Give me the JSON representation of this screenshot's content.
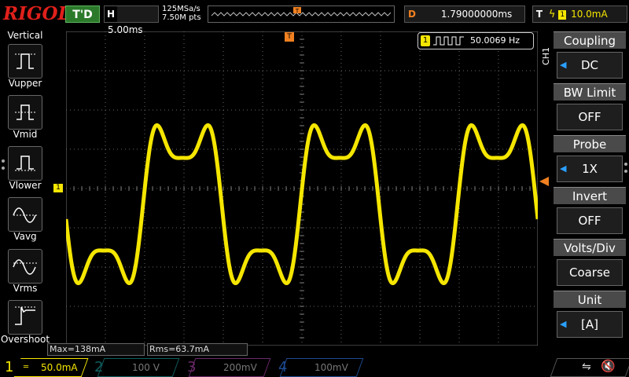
{
  "header": {
    "brand": "RIGOL",
    "trigger_status": "T'D",
    "timebase_label": "H",
    "timebase_value": "5.00ms",
    "sample_rate": "125MSa/s",
    "memory_points": "7.50M pts",
    "delay_label": "D",
    "delay_value": "1.79000000ms",
    "trigger_label": "T",
    "trigger_level": "10.0mA"
  },
  "left_menu": {
    "title": "Vertical",
    "items": [
      {
        "label": "Vupper",
        "icon": "vupper-icon"
      },
      {
        "label": "Vmid",
        "icon": "vmid-icon"
      },
      {
        "label": "Vlower",
        "icon": "vlower-icon"
      },
      {
        "label": "Vavg",
        "icon": "vavg-icon"
      },
      {
        "label": "Vrms",
        "icon": "vrms-icon"
      },
      {
        "label": "Overshoot",
        "icon": "overshoot-icon"
      }
    ]
  },
  "display": {
    "frequency_counter_label": "1",
    "frequency_value": "50.0069 Hz",
    "channel_marker": "1",
    "trace_color": "#f5e600"
  },
  "measurements": {
    "max": "Max=138mA",
    "rms": "Rms=63.7mA"
  },
  "channels": [
    {
      "num": "1",
      "scale": "50.0mA",
      "color": "#f5e600",
      "active": true
    },
    {
      "num": "2",
      "scale": "100 V",
      "color": "#00c0c0",
      "active": false
    },
    {
      "num": "3",
      "scale": "200mV",
      "color": "#d040d0",
      "active": false
    },
    {
      "num": "4",
      "scale": "100mV",
      "color": "#2a7aff",
      "active": false
    }
  ],
  "right_menu": {
    "channel_label": "CH1",
    "items": [
      {
        "title": "Coupling",
        "value": "DC",
        "has_arrow": true
      },
      {
        "title": "BW Limit",
        "value": "OFF",
        "has_arrow": false
      },
      {
        "title": "Probe",
        "value": "1X",
        "has_arrow": true
      },
      {
        "title": "Invert",
        "value": "OFF",
        "has_arrow": false
      },
      {
        "title": "Volts/Div",
        "value": "Coarse",
        "has_arrow": false
      },
      {
        "title": "Unit",
        "value": "[A]",
        "has_arrow": true
      }
    ]
  }
}
